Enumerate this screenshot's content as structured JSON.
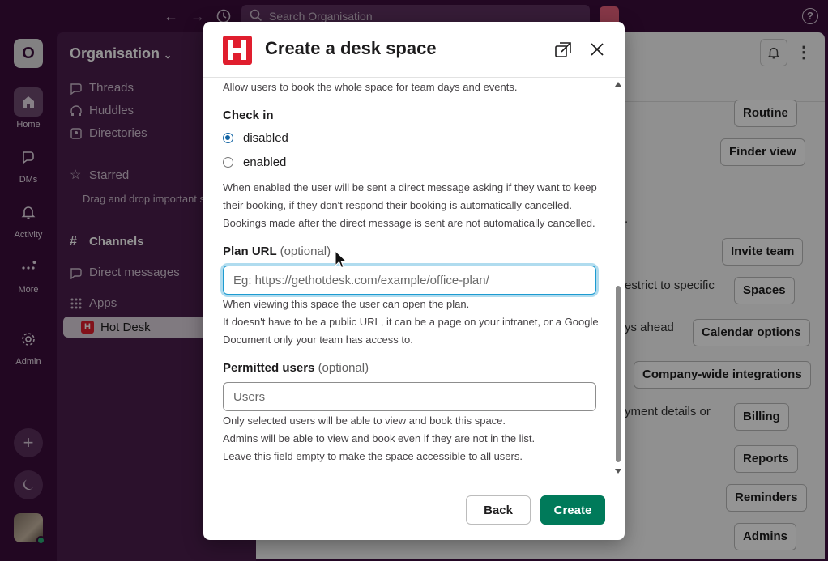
{
  "topbar": {
    "search_placeholder": "Search Organisation",
    "help_label": "?"
  },
  "rail": {
    "workspace_initial": "O",
    "items": [
      {
        "label": "Home"
      },
      {
        "label": "DMs"
      },
      {
        "label": "Activity"
      },
      {
        "label": "More"
      },
      {
        "label": "Admin"
      }
    ]
  },
  "sidebar": {
    "org_name": "Organisation",
    "items": [
      {
        "label": "Threads"
      },
      {
        "label": "Huddles"
      },
      {
        "label": "Directories"
      },
      {
        "label": "Starred"
      }
    ],
    "starred_hint": "Drag and drop important stuff here",
    "channels_label": "Channels",
    "direct_messages_label": "Direct messages",
    "apps_label": "Apps",
    "active_app": "Hot Desk",
    "active_app_icon": "H"
  },
  "main": {
    "buttons": [
      "Routine",
      "Finder view",
      "Invite team",
      "Spaces",
      "Calendar options",
      "Company-wide integrations",
      "Billing",
      "Reports",
      "Reminders",
      "Admins"
    ],
    "partial_texts": [
      ".",
      "estrict to specific",
      "ys ahead",
      "yment details or"
    ]
  },
  "modal": {
    "title": "Create a desk space",
    "whole_space_help": "Allow users to book the whole space for team days and events.",
    "checkin": {
      "label": "Check in",
      "options": [
        {
          "label": "disabled",
          "checked": true
        },
        {
          "label": "enabled",
          "checked": false
        }
      ],
      "help": "When enabled the user will be sent a direct message asking if they want to keep their booking, if they don't respond their booking is automatically cancelled. Bookings made after the direct message is sent are not automatically cancelled."
    },
    "plan_url": {
      "label": "Plan URL",
      "optional": "(optional)",
      "value": "",
      "placeholder": "Eg: https://gethotdesk.com/example/office-plan/",
      "help_line1": "When viewing this space the user can open the plan.",
      "help_line2": "It doesn't have to be a public URL, it can be a page on your intranet, or a Google Document only your team has access to."
    },
    "permitted_users": {
      "label": "Permitted users",
      "optional": "(optional)",
      "value": "",
      "placeholder": "Users",
      "help_line1": "Only selected users will be able to view and book this space.",
      "help_line2": "Admins will be able to view and book even if they are not in the list.",
      "help_line3": "Leave this field empty to make the space accessible to all users."
    },
    "back_label": "Back",
    "create_label": "Create"
  },
  "colors": {
    "primary_button": "#007a5a",
    "brand_red": "#e01e2e",
    "focus_ring": "#1d9bd1",
    "radio_checked": "#1264a3",
    "sidebar_bg": "#4b1e4c"
  }
}
